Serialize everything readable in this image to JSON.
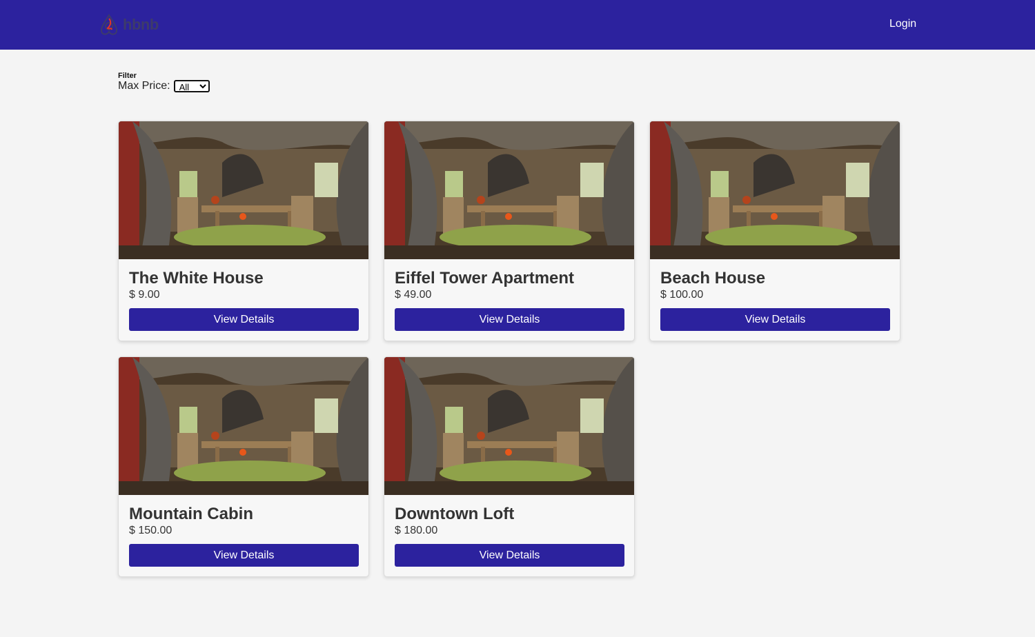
{
  "header": {
    "logo_text": "hbnb",
    "login_label": "Login"
  },
  "filter": {
    "title": "Filter",
    "label": "Max Price:",
    "selected": "All"
  },
  "places": [
    {
      "name": "The White House",
      "price": "$ 9.00",
      "button": "View Details"
    },
    {
      "name": "Eiffel Tower Apartment",
      "price": "$ 49.00",
      "button": "View Details"
    },
    {
      "name": "Beach House",
      "price": "$ 100.00",
      "button": "View Details"
    },
    {
      "name": "Mountain Cabin",
      "price": "$ 150.00",
      "button": "View Details"
    },
    {
      "name": "Downtown Loft",
      "price": "$ 180.00",
      "button": "View Details"
    }
  ],
  "colors": {
    "header": "#2c229e",
    "button": "#2c229e",
    "background": "#f4f4f4"
  }
}
